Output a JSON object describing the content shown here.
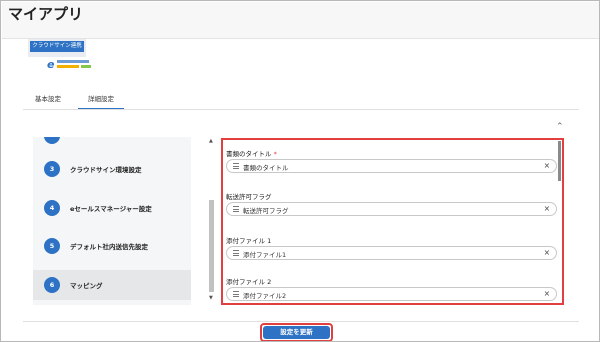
{
  "app": {
    "title": "マイアプリ",
    "badge_label": "クラウドサイン連携"
  },
  "tabs": [
    {
      "label": "基本設定",
      "active": false
    },
    {
      "label": "詳細設定",
      "active": true
    }
  ],
  "steps": [
    {
      "number": "3",
      "label": "クラウドサイン環境設定",
      "active": false
    },
    {
      "number": "4",
      "label": "eセールスマネージャー設定",
      "active": false
    },
    {
      "number": "5",
      "label": "デフォルト社内送信先設定",
      "active": false
    },
    {
      "number": "6",
      "label": "マッピング",
      "active": true
    }
  ],
  "mapping": {
    "fields": [
      {
        "label": "書類のタイトル",
        "required_mark": "*",
        "value": "書類のタイトル"
      },
      {
        "label": "転送許可フラグ",
        "required_mark": "",
        "value": "転送許可フラグ"
      },
      {
        "label": "添付ファイル 1",
        "required_mark": "",
        "value": "添付ファイル1"
      },
      {
        "label": "添付ファイル 2",
        "required_mark": "",
        "value": "添付ファイル2"
      }
    ]
  },
  "actions": {
    "update_label": "設定を更新"
  },
  "icons": {
    "collapse": "chevron-up-icon",
    "field_handle": "menu-icon",
    "clear": "close-icon"
  },
  "colors": {
    "accent": "#2d72c4",
    "highlight": "#e24040"
  }
}
